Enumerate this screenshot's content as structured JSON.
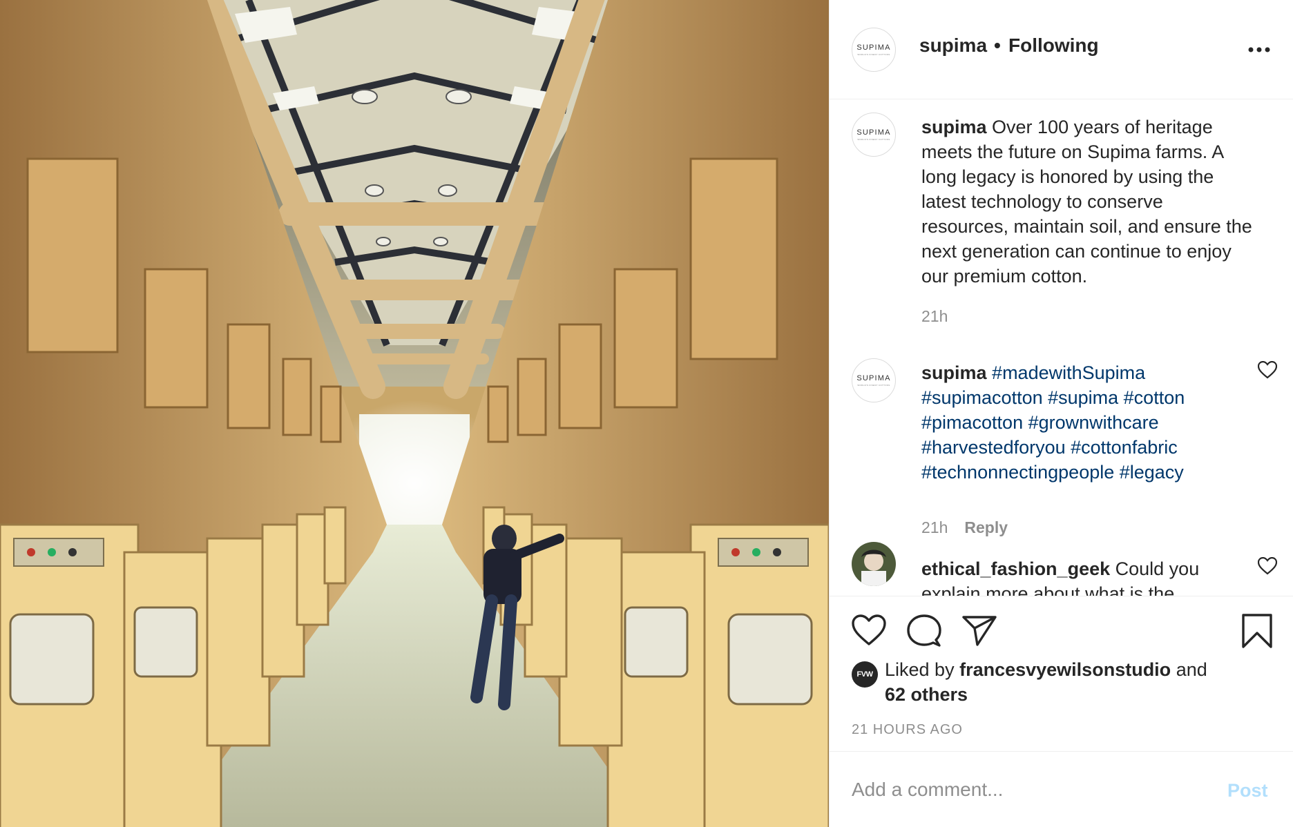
{
  "post": {
    "username": "supima",
    "separator": "•",
    "follow_status": "Following",
    "avatar_logo": "SUPIMA",
    "avatar_tagline": "WORLD'S FINEST COTTONS"
  },
  "comments": [
    {
      "username": "supima",
      "text": " Over 100 years of heritage meets the future on Supima farms. A long legacy is honored by using the latest technology to conserve resources, maintain soil, and ensure the next generation can continue to enjoy our premium cotton.",
      "time": "21h"
    },
    {
      "username": "supima",
      "hashtags": "#madewithSupima #supimacotton #supima #cotton #pimacotton #grownwithcare #harvestedforyou #cottonfabric #technonnectingpeople #legacy",
      "time": "21h",
      "reply_label": "Reply"
    },
    {
      "username": "ethical_fashion_geek",
      "text": " Could you explain more about what is the"
    }
  ],
  "likes": {
    "badge": "FVW",
    "prefix": "Liked by ",
    "liker": "francesvyewilsonstudio",
    "and": " and",
    "others": "62 others"
  },
  "timestamp": "21 HOURS AGO",
  "add_comment": {
    "placeholder": "Add a comment...",
    "post_label": "Post"
  },
  "colors": {
    "hashtag": "#00376b",
    "post_button_disabled": "#b2dffc",
    "muted": "#8e8e8e"
  }
}
